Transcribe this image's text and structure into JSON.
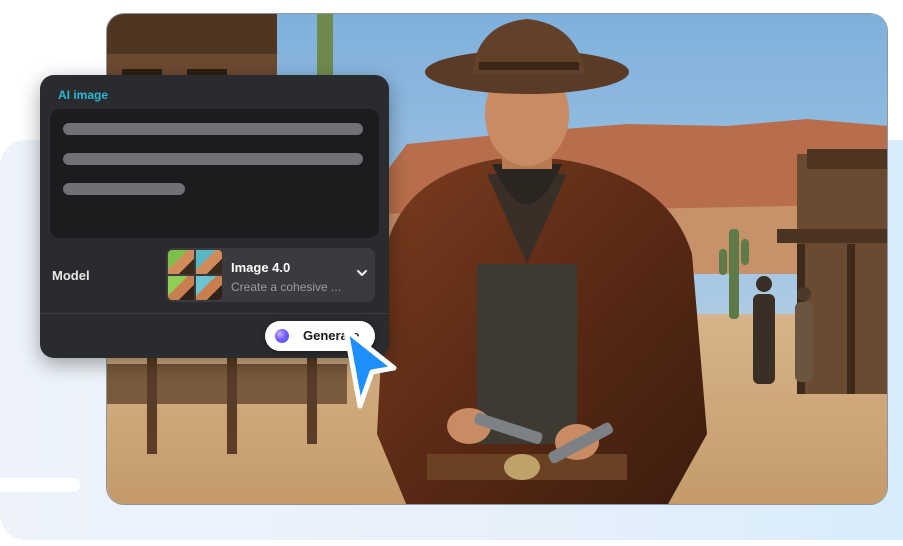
{
  "panel": {
    "title": "AI image",
    "model_label": "Model",
    "model_name": "Image 4.0",
    "model_description": "Create a cohesive ...",
    "generate_label": "Generate"
  },
  "icons": {
    "dropdown": "chevron-down-icon",
    "generate": "sparkle-orb-icon",
    "cursor": "pointer-cursor-icon"
  },
  "colors": {
    "accent": "#2bb6d6",
    "panel_bg": "#2a2b2e",
    "cursor": "#1e8fff"
  }
}
